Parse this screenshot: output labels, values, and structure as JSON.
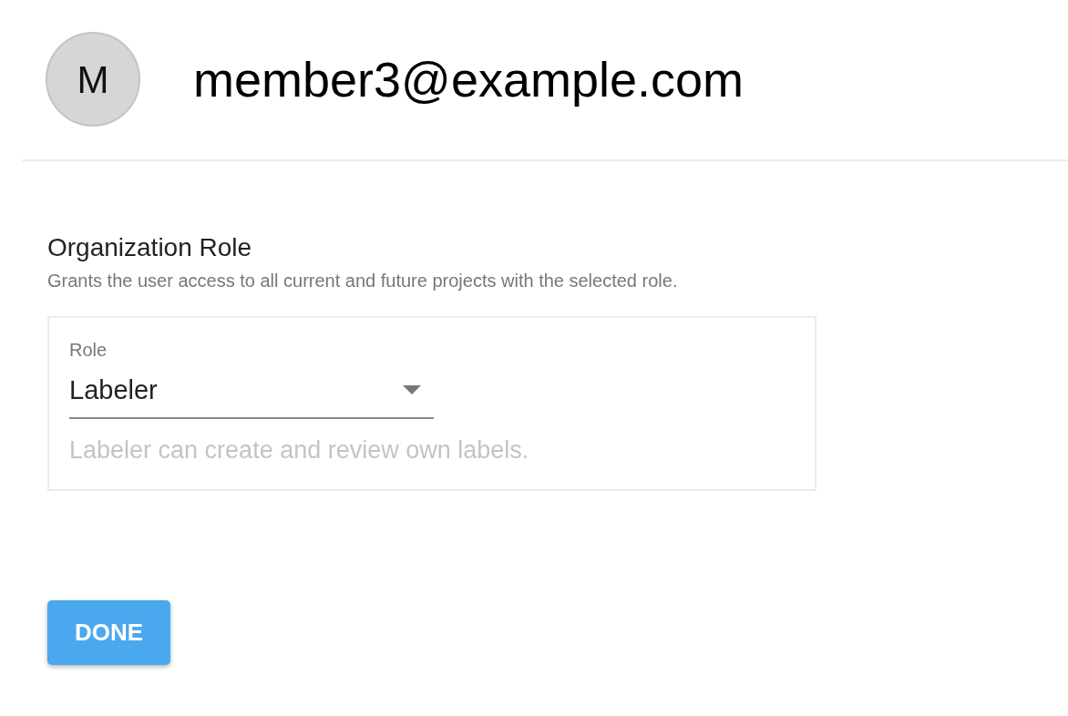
{
  "user": {
    "avatar_initial": "M",
    "email": "member3@example.com"
  },
  "section": {
    "title": "Organization Role",
    "description": "Grants the user access to all current and future projects with the selected role."
  },
  "role_field": {
    "label": "Role",
    "value": "Labeler",
    "helper": "Labeler can create and review own labels."
  },
  "buttons": [
    {
      "label": "DONE"
    }
  ]
}
